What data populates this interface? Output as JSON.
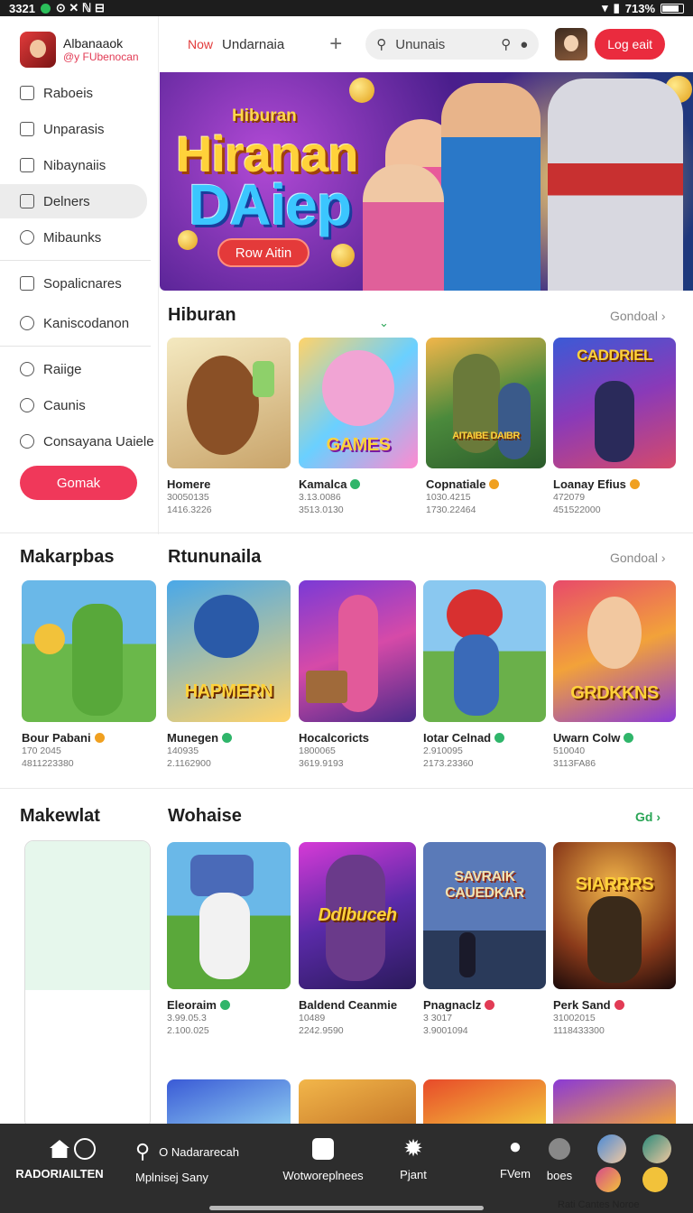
{
  "status_bar": {
    "time": "3321",
    "icons_left": "⊙ ✕ ℕ ⊟",
    "battery_text": "713%"
  },
  "sidebar": {
    "profile_name": "Albanaaok",
    "profile_sub": "@y FUbenocan",
    "items": [
      {
        "label": "Raboeis",
        "icon": "bookmark-icon"
      },
      {
        "label": "Unparasis",
        "icon": "share-icon"
      },
      {
        "label": "Nibaynaiis",
        "icon": "share-icon"
      },
      {
        "label": "Delners",
        "icon": "folder-icon",
        "active": true
      },
      {
        "label": "Mibaunks",
        "icon": "search-icon"
      },
      {
        "label": "Sopalicnares",
        "icon": "document-icon"
      },
      {
        "label": "Kaniscodanon",
        "icon": "search-icon"
      },
      {
        "label": "Raiige",
        "icon": "circle-icon"
      },
      {
        "label": "Caunis",
        "icon": "search-icon"
      },
      {
        "label": "Consayana Uaiele",
        "icon": "search-icon"
      }
    ],
    "button_label": "Gomak"
  },
  "topbar": {
    "now_label": "Now",
    "title": "Undarnaia",
    "plus": "+",
    "search_placeholder": "Ununais",
    "login_label": "Log eait"
  },
  "hero": {
    "small_text": "Hiburan",
    "big_line1": "Hiranan",
    "big_line2": "DAiep",
    "button_label": "Row Aitin"
  },
  "sections": [
    {
      "title": "Hiburan",
      "more": "Gondoal ›",
      "chevron": "⌄",
      "cards": [
        {
          "name": "Homere",
          "badge_color": "",
          "stat1": "30050135",
          "stat2": "1416.3226",
          "thumb_title": ""
        },
        {
          "name": "Kamalca",
          "badge_color": "#2fb56a",
          "stat1": "3.13.0086",
          "stat2": "3513.0130",
          "thumb_title": "GAMES"
        },
        {
          "name": "Copnatiale",
          "badge_color": "#f0a020",
          "stat1": "1030.4215",
          "stat2": "1730.22464",
          "thumb_title": "AITAIBE DAIBR"
        },
        {
          "name": "Loanay Efius",
          "badge_color": "#f0a020",
          "stat1": "472079",
          "stat2": "451522000",
          "thumb_title": "CADDRIEL"
        }
      ]
    },
    {
      "title": "Rtununaila",
      "more": "Gondoal ›",
      "left_title": "Makarpbas",
      "cards": [
        {
          "name": "Bour Pabani",
          "badge_color": "#f0a020",
          "stat1": "170 2045",
          "stat2": "4811223380",
          "thumb_title": ""
        },
        {
          "name": "Munegen",
          "badge_color": "#2fb56a",
          "stat1": "140935",
          "stat2": "2.1162900",
          "thumb_title": "HAPMERN"
        },
        {
          "name": "Hocalcoricts",
          "badge_color": "",
          "stat1": "1800065",
          "stat2": "3619.9193",
          "thumb_title": ""
        },
        {
          "name": "Iotar Celnad",
          "badge_color": "#2fb56a",
          "stat1": "2.910095",
          "stat2": "2173.23360",
          "thumb_title": ""
        },
        {
          "name": "Uwarn Colw",
          "badge_color": "#2fb56a",
          "stat1": "510040",
          "stat2": "3113FA86",
          "thumb_title": "GRDKKNS"
        }
      ]
    },
    {
      "title": "Wohaise",
      "more": "Gd ›",
      "left_title": "Makewlat",
      "cards": [
        {
          "name": "Eleoraim",
          "badge_color": "#2fb56a",
          "stat1": "3.99.05.3",
          "stat2": "2.100.025",
          "thumb_title": ""
        },
        {
          "name": "Baldend Ceanmie",
          "badge_color": "",
          "stat1": "10489",
          "stat2": "2242.9590",
          "thumb_title": "Ddlbuceh"
        },
        {
          "name": "Pnagnaclz",
          "badge_color": "#e23b55",
          "stat1": "3 3017",
          "stat2": "3.9001094",
          "thumb_title": "SAVRAIK CAUEDKAR"
        },
        {
          "name": "Perk Sand",
          "badge_color": "#e23b55",
          "stat1": "31002015",
          "stat2": "1118433300",
          "thumb_title": "SIARRRS"
        }
      ]
    }
  ],
  "bottom_nav": {
    "items": [
      {
        "label": "RADORIAILTEN",
        "icon": "home-icon"
      },
      {
        "label": "Mplnisej Sany",
        "icon": "search-icon"
      },
      {
        "label": "Wotworeplnees",
        "icon": "game-icon"
      },
      {
        "label": "Pjant",
        "icon": "settings-icon"
      },
      {
        "label": "FVem",
        "icon": "user-icon"
      },
      {
        "label": "boes",
        "icon": "chat-icon"
      }
    ],
    "search_text": "O Nadararecah",
    "corner_note": "Rati Cantes Noroe"
  },
  "colors": {
    "accent": "#ea2b3e",
    "dark_nav": "#2d2d2d",
    "active_item": "#ececec"
  }
}
